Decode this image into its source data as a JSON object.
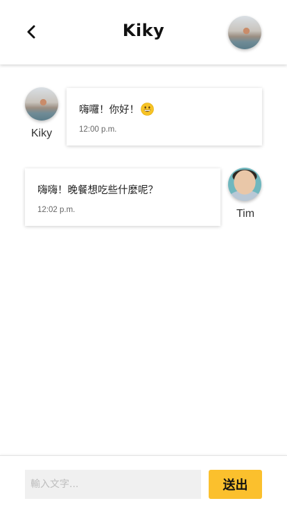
{
  "header": {
    "title": "Kiky",
    "back_icon": "chevron-left-icon",
    "contact_avatar": "kiky-avatar"
  },
  "messages": [
    {
      "sender": "Kiky",
      "text": "嗨囉！你好！",
      "emoji": "grinning-face-emoji",
      "time": "12:00 p.m.",
      "side": "left"
    },
    {
      "sender": "Tim",
      "text": "嗨嗨！晚餐想吃些什麼呢？",
      "time": "12:02 p.m.",
      "side": "right"
    }
  ],
  "composer": {
    "placeholder": "輸入文字...",
    "value": "",
    "send_label": "送出"
  },
  "colors": {
    "accent": "#fbc02d",
    "input_background": "#f0f0f0",
    "bubble_background": "#ffffff"
  }
}
